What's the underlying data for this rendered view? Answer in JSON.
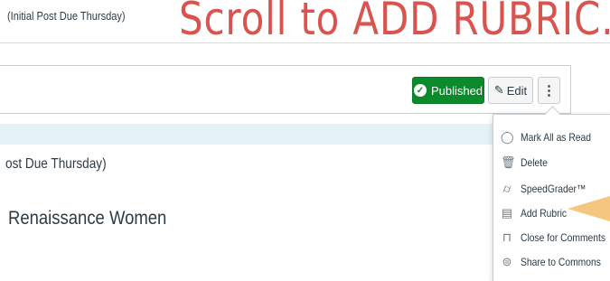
{
  "breadcrumb": "(Initial Post Due Thursday)",
  "banner": "Scroll to ADD RUBRIC.",
  "toolbar": {
    "published_label": "Published",
    "edit_label": "Edit",
    "more_label": "⋮"
  },
  "content": {
    "line1": "ost Due Thursday)",
    "title": "Renaissance Women"
  },
  "menu": {
    "items": [
      {
        "label": "Mark All as Read",
        "icon": "circle-icon"
      },
      {
        "label": "Delete",
        "icon": "trash-icon"
      },
      {
        "label": "SpeedGrader™",
        "icon": "speedgrader-icon"
      },
      {
        "label": "Add Rubric",
        "icon": "rubric-icon"
      },
      {
        "label": "Close for Comments",
        "icon": "lock-icon"
      },
      {
        "label": "Share to Commons",
        "icon": "share-icon"
      }
    ]
  },
  "colors": {
    "banner": "#d9534f",
    "published": "#0b8a2c",
    "info_bar": "#e5f2f8",
    "pointer": "#f5c77e"
  }
}
